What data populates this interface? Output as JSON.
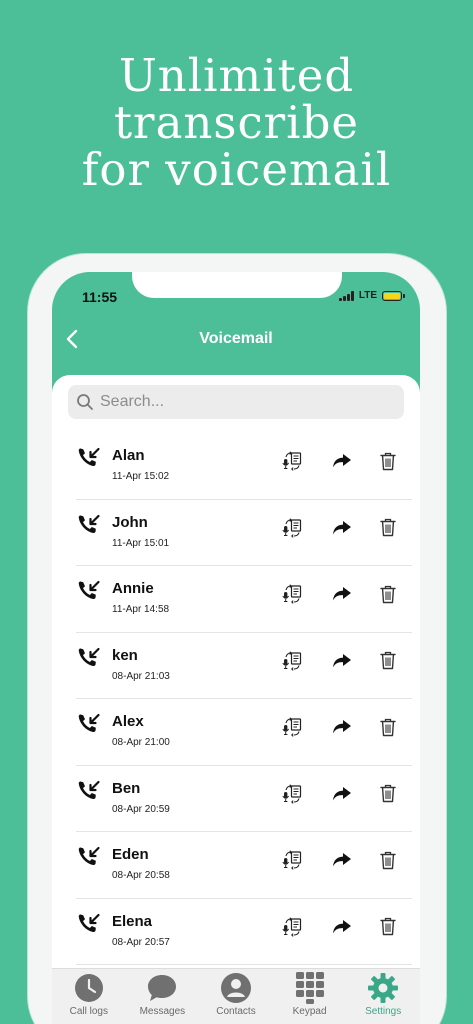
{
  "headline": [
    "Unlimited",
    "transcribe",
    "for voicemail"
  ],
  "status": {
    "time": "11:55",
    "network": "LTE"
  },
  "nav": {
    "title": "Voicemail"
  },
  "search": {
    "placeholder": "Search..."
  },
  "voicemails": [
    {
      "name": "Alan",
      "time": "11-Apr 15:02"
    },
    {
      "name": "John",
      "time": "11-Apr 15:01"
    },
    {
      "name": "Annie",
      "time": "11-Apr 14:58"
    },
    {
      "name": "ken",
      "time": "08-Apr 21:03"
    },
    {
      "name": "Alex",
      "time": "08-Apr 21:00"
    },
    {
      "name": "Ben",
      "time": "08-Apr 20:59"
    },
    {
      "name": "Eden",
      "time": "08-Apr 20:58"
    },
    {
      "name": "Elena",
      "time": "08-Apr 20:57"
    }
  ],
  "tabs": [
    {
      "label": "Call logs",
      "icon": "clock-icon"
    },
    {
      "label": "Messages",
      "icon": "chat-bubble-icon"
    },
    {
      "label": "Contacts",
      "icon": "person-icon"
    },
    {
      "label": "Keypad",
      "icon": "keypad-icon"
    },
    {
      "label": "Settings",
      "icon": "gear-icon",
      "active": true
    }
  ],
  "colors": {
    "brand": "#4cbf98",
    "active_tab": "#3aa888",
    "battery": "#f5d51c"
  }
}
